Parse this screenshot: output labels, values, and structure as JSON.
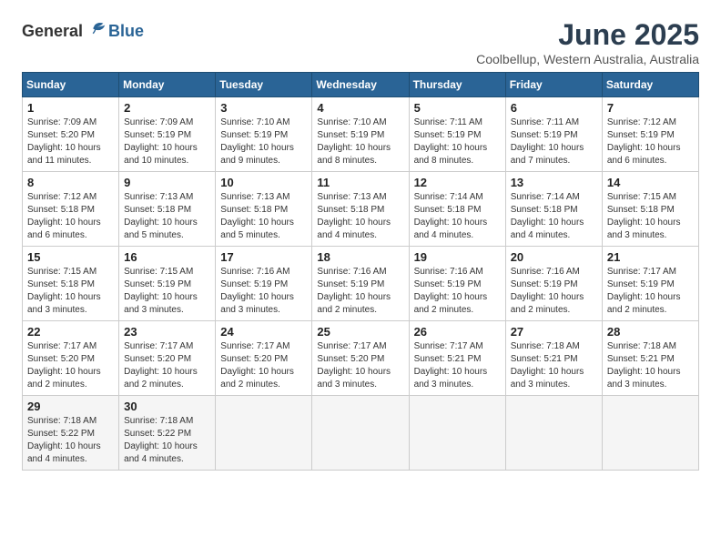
{
  "header": {
    "logo_general": "General",
    "logo_blue": "Blue",
    "title": "June 2025",
    "subtitle": "Coolbellup, Western Australia, Australia"
  },
  "columns": [
    "Sunday",
    "Monday",
    "Tuesday",
    "Wednesday",
    "Thursday",
    "Friday",
    "Saturday"
  ],
  "weeks": [
    [
      {
        "day": "1",
        "info": "Sunrise: 7:09 AM\nSunset: 5:20 PM\nDaylight: 10 hours\nand 11 minutes."
      },
      {
        "day": "2",
        "info": "Sunrise: 7:09 AM\nSunset: 5:19 PM\nDaylight: 10 hours\nand 10 minutes."
      },
      {
        "day": "3",
        "info": "Sunrise: 7:10 AM\nSunset: 5:19 PM\nDaylight: 10 hours\nand 9 minutes."
      },
      {
        "day": "4",
        "info": "Sunrise: 7:10 AM\nSunset: 5:19 PM\nDaylight: 10 hours\nand 8 minutes."
      },
      {
        "day": "5",
        "info": "Sunrise: 7:11 AM\nSunset: 5:19 PM\nDaylight: 10 hours\nand 8 minutes."
      },
      {
        "day": "6",
        "info": "Sunrise: 7:11 AM\nSunset: 5:19 PM\nDaylight: 10 hours\nand 7 minutes."
      },
      {
        "day": "7",
        "info": "Sunrise: 7:12 AM\nSunset: 5:19 PM\nDaylight: 10 hours\nand 6 minutes."
      }
    ],
    [
      {
        "day": "8",
        "info": "Sunrise: 7:12 AM\nSunset: 5:18 PM\nDaylight: 10 hours\nand 6 minutes."
      },
      {
        "day": "9",
        "info": "Sunrise: 7:13 AM\nSunset: 5:18 PM\nDaylight: 10 hours\nand 5 minutes."
      },
      {
        "day": "10",
        "info": "Sunrise: 7:13 AM\nSunset: 5:18 PM\nDaylight: 10 hours\nand 5 minutes."
      },
      {
        "day": "11",
        "info": "Sunrise: 7:13 AM\nSunset: 5:18 PM\nDaylight: 10 hours\nand 4 minutes."
      },
      {
        "day": "12",
        "info": "Sunrise: 7:14 AM\nSunset: 5:18 PM\nDaylight: 10 hours\nand 4 minutes."
      },
      {
        "day": "13",
        "info": "Sunrise: 7:14 AM\nSunset: 5:18 PM\nDaylight: 10 hours\nand 4 minutes."
      },
      {
        "day": "14",
        "info": "Sunrise: 7:15 AM\nSunset: 5:18 PM\nDaylight: 10 hours\nand 3 minutes."
      }
    ],
    [
      {
        "day": "15",
        "info": "Sunrise: 7:15 AM\nSunset: 5:18 PM\nDaylight: 10 hours\nand 3 minutes."
      },
      {
        "day": "16",
        "info": "Sunrise: 7:15 AM\nSunset: 5:19 PM\nDaylight: 10 hours\nand 3 minutes."
      },
      {
        "day": "17",
        "info": "Sunrise: 7:16 AM\nSunset: 5:19 PM\nDaylight: 10 hours\nand 3 minutes."
      },
      {
        "day": "18",
        "info": "Sunrise: 7:16 AM\nSunset: 5:19 PM\nDaylight: 10 hours\nand 2 minutes."
      },
      {
        "day": "19",
        "info": "Sunrise: 7:16 AM\nSunset: 5:19 PM\nDaylight: 10 hours\nand 2 minutes."
      },
      {
        "day": "20",
        "info": "Sunrise: 7:16 AM\nSunset: 5:19 PM\nDaylight: 10 hours\nand 2 minutes."
      },
      {
        "day": "21",
        "info": "Sunrise: 7:17 AM\nSunset: 5:19 PM\nDaylight: 10 hours\nand 2 minutes."
      }
    ],
    [
      {
        "day": "22",
        "info": "Sunrise: 7:17 AM\nSunset: 5:20 PM\nDaylight: 10 hours\nand 2 minutes."
      },
      {
        "day": "23",
        "info": "Sunrise: 7:17 AM\nSunset: 5:20 PM\nDaylight: 10 hours\nand 2 minutes."
      },
      {
        "day": "24",
        "info": "Sunrise: 7:17 AM\nSunset: 5:20 PM\nDaylight: 10 hours\nand 2 minutes."
      },
      {
        "day": "25",
        "info": "Sunrise: 7:17 AM\nSunset: 5:20 PM\nDaylight: 10 hours\nand 3 minutes."
      },
      {
        "day": "26",
        "info": "Sunrise: 7:17 AM\nSunset: 5:21 PM\nDaylight: 10 hours\nand 3 minutes."
      },
      {
        "day": "27",
        "info": "Sunrise: 7:18 AM\nSunset: 5:21 PM\nDaylight: 10 hours\nand 3 minutes."
      },
      {
        "day": "28",
        "info": "Sunrise: 7:18 AM\nSunset: 5:21 PM\nDaylight: 10 hours\nand 3 minutes."
      }
    ],
    [
      {
        "day": "29",
        "info": "Sunrise: 7:18 AM\nSunset: 5:22 PM\nDaylight: 10 hours\nand 4 minutes."
      },
      {
        "day": "30",
        "info": "Sunrise: 7:18 AM\nSunset: 5:22 PM\nDaylight: 10 hours\nand 4 minutes."
      },
      {
        "day": "",
        "info": ""
      },
      {
        "day": "",
        "info": ""
      },
      {
        "day": "",
        "info": ""
      },
      {
        "day": "",
        "info": ""
      },
      {
        "day": "",
        "info": ""
      }
    ]
  ]
}
